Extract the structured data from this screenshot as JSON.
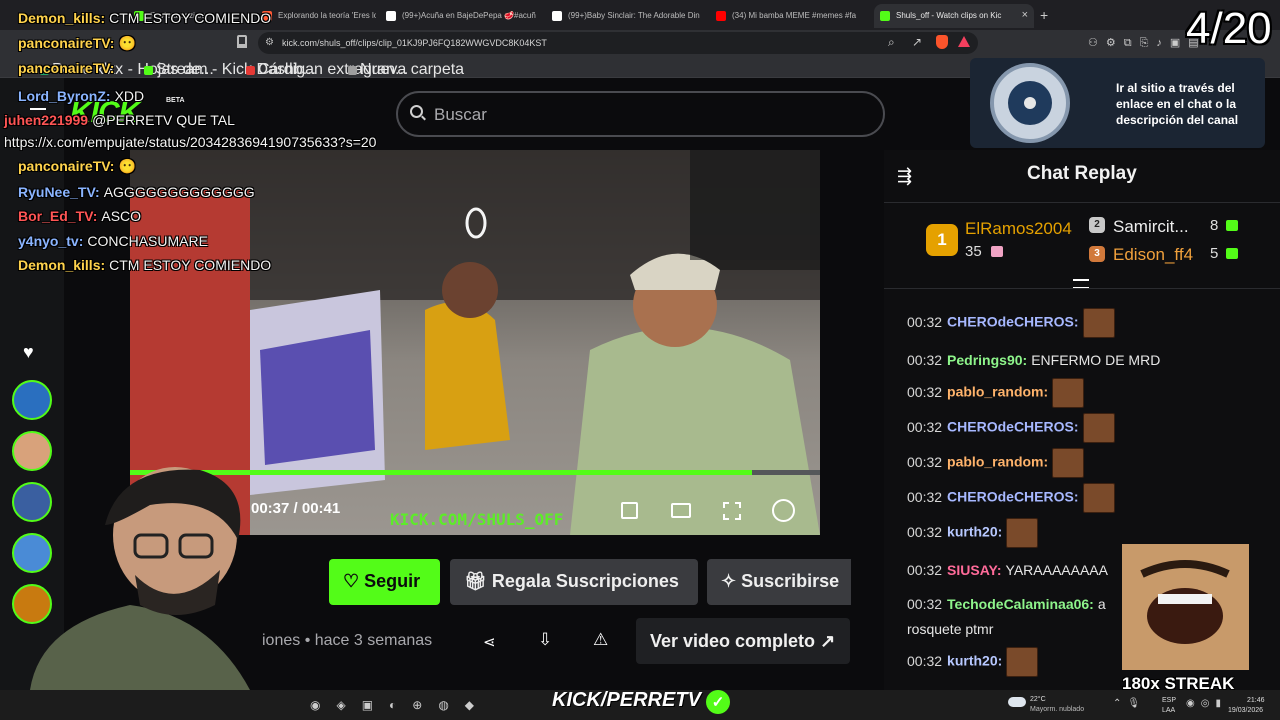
{
  "browser": {
    "tabs": [
      {
        "label": "Rovieraranzi.co",
        "color": "#53fc18",
        "active": false
      },
      {
        "label": "Explorando la teoría 'Eres lo qu",
        "color": "#ff5a36",
        "active": false
      },
      {
        "label": "(99+)Acuña en BajeDePepa 🥩#acuñ",
        "color": "#ffffff",
        "active": false
      },
      {
        "label": "(99+)Baby Sinclair: The Adorable Din",
        "color": "#ffffff",
        "active": false
      },
      {
        "label": "(34) Mi bamba MEME #memes #fa",
        "color": "#ff0000",
        "active": false
      },
      {
        "label": "Shuls_off - Watch clips on Kic",
        "color": "#53fc18",
        "active": true
      }
    ],
    "url": "kick.com/shuls_off/clips/clip_01KJ9PJ6FQ182WWGVDC8K04KST",
    "bookmarks": [
      {
        "label": "Perro xlxx - Hojas de...",
        "color": "#21a366"
      },
      {
        "label": "Stream - Kick Dashb...",
        "color": "#53fc18"
      },
      {
        "label": "Cárdigan extragran...",
        "color": "#e53935"
      },
      {
        "label": "Nueva carpeta",
        "color": "#9e9e9e"
      }
    ]
  },
  "site": {
    "logo": "KICK",
    "badge": "BETA",
    "search_placeholder": "Buscar",
    "accent": "#53fc18"
  },
  "player": {
    "time": "00:37 / 00:41",
    "progress": 0.902,
    "watermark": "KICK.COM/SHULS_OFF"
  },
  "actions": {
    "follow": "Seguir",
    "gift": "Regala Suscripciones",
    "subscribe": "Suscribirse",
    "meta": "iones • hace 3 semanas",
    "full_video": "Ver video completo"
  },
  "chat": {
    "title": "Chat Replay",
    "leaders": [
      {
        "rank": "1",
        "name": "ElRamos2004",
        "count": "35"
      },
      {
        "rank": "2",
        "name": "Samircit...",
        "count": "8"
      },
      {
        "rank": "3",
        "name": "Edison_ff4",
        "count": "5"
      }
    ],
    "messages": [
      {
        "time": "00:32",
        "user": "CHEROdeCHEROS:",
        "color": "#a7b8ff",
        "text": "",
        "emote": true
      },
      {
        "time": "00:32",
        "user": "Pedrings90:",
        "color": "#8ef58b",
        "text": "ENFERMO DE MRD",
        "emote": false
      },
      {
        "time": "00:32",
        "user": "pablo_random:",
        "color": "#ffb36b",
        "text": "",
        "emote": true
      },
      {
        "time": "00:32",
        "user": "CHEROdeCHEROS:",
        "color": "#a7b8ff",
        "text": "",
        "emote": true
      },
      {
        "time": "00:32",
        "user": "pablo_random:",
        "color": "#ffb36b",
        "text": "",
        "emote": true
      },
      {
        "time": "00:32",
        "user": "CHEROdeCHEROS:",
        "color": "#a7b8ff",
        "text": "",
        "emote": true
      },
      {
        "time": "00:32",
        "user": "kurth20:",
        "color": "#b7c8ff",
        "text": "",
        "emote": true
      },
      {
        "time": "00:32",
        "user": "SIUSAY:",
        "color": "#ff6b9a",
        "text": "YARAAAAAAAA",
        "emote": false
      },
      {
        "time": "00:32",
        "user": "TechodeCalaminaa06:",
        "color": "#8ef58b",
        "text": "a",
        "emote": false
      },
      {
        "time": "",
        "user": "",
        "color": "#e6e6e6",
        "text": "rosquete ptmr",
        "emote": false
      },
      {
        "time": "00:32",
        "user": "kurth20:",
        "color": "#b7c8ff",
        "text": "",
        "emote": true
      }
    ]
  },
  "overlay_chat": [
    {
      "user": "Demon_kills:",
      "color": "#ffd34d",
      "text": "CTM ESTOY COMIENDO"
    },
    {
      "user": "panconaireTV:",
      "color": "#ffd34d",
      "text": "😶"
    },
    {
      "user": "panconaireTV:",
      "color": "#ffd34d",
      "text": ""
    },
    {
      "user": "Lord_ByronZ:",
      "color": "#8ab4ff",
      "text": "XDD"
    },
    {
      "user": "juhen221999",
      "color": "#ff5555",
      "text": "@PERRETV QUE TAL"
    },
    {
      "user": "",
      "color": "#ffffff",
      "text": "https://x.com/empujate/status/2034283694190735633?s=20"
    },
    {
      "user": "panconaireTV:",
      "color": "#ffd34d",
      "text": "😶"
    },
    {
      "user": "RyuNee_TV:",
      "color": "#8ab4ff",
      "text": "AGGGGGGGGGGGGG"
    },
    {
      "user": "Bor_Ed_TV:",
      "color": "#ff5555",
      "text": "ASCO"
    },
    {
      "user": "y4nyo_tv:",
      "color": "#8ab4ff",
      "text": "CONCHASUMARE"
    },
    {
      "user": "Demon_kills:",
      "color": "#ffd34d",
      "text": "CTM ESTOY COMIENDO"
    }
  ],
  "overlay": {
    "counter": "4/20",
    "promo": "Ir al sitio a través del enlace en el chat o la descripción del canal",
    "streak": "180x STREAK",
    "kick_name": "KICK/PERRETV"
  },
  "taskbar": {
    "weather_temp": "22°C",
    "weather_desc": "Mayorm. nublado",
    "lang": "ESP",
    "lang2": "LAA",
    "time": "21:46",
    "date": "19/03/2026"
  }
}
